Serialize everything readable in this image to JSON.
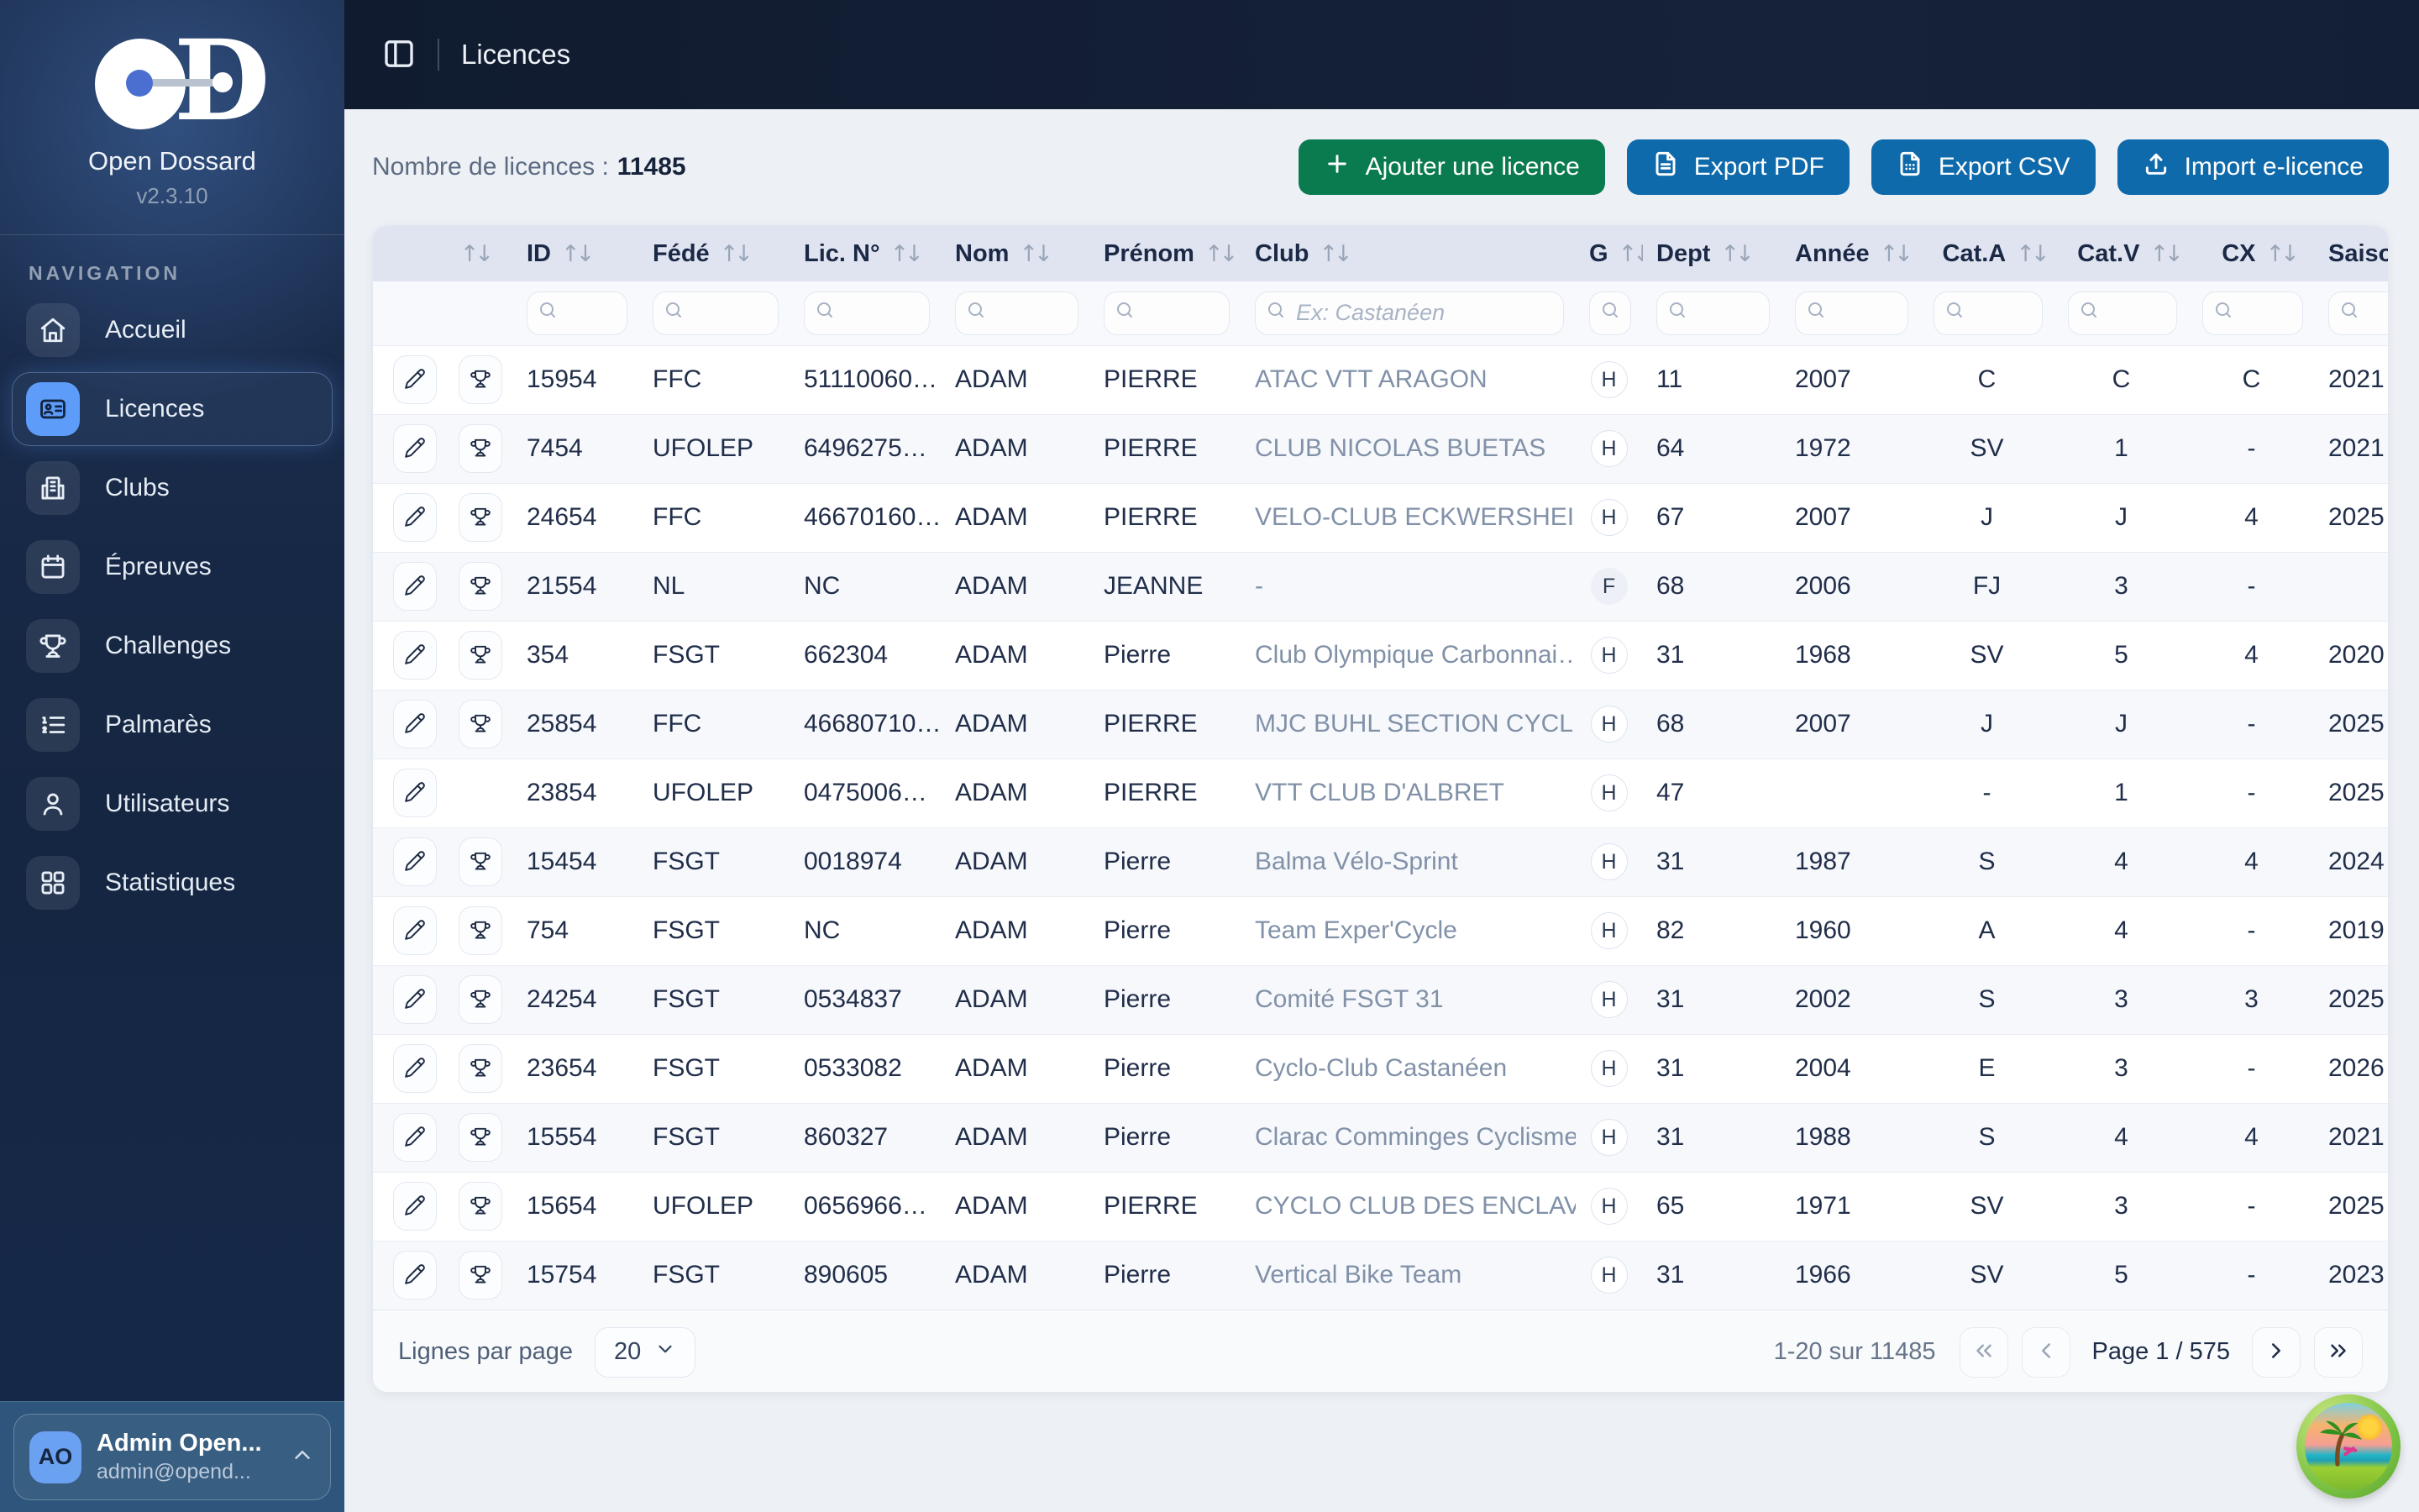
{
  "app": {
    "name": "Open Dossard",
    "version": "v2.3.10"
  },
  "topbar": {
    "title": "Licences"
  },
  "sidebar": {
    "section_label": "NAVIGATION",
    "items": [
      {
        "id": "accueil",
        "label": "Accueil",
        "icon": "home",
        "active": false
      },
      {
        "id": "licences",
        "label": "Licences",
        "icon": "id-card",
        "active": true
      },
      {
        "id": "clubs",
        "label": "Clubs",
        "icon": "building",
        "active": false
      },
      {
        "id": "epreuves",
        "label": "Épreuves",
        "icon": "calendar",
        "active": false
      },
      {
        "id": "challenges",
        "label": "Challenges",
        "icon": "trophy",
        "active": false
      },
      {
        "id": "palmares",
        "label": "Palmarès",
        "icon": "list-ordered",
        "active": false
      },
      {
        "id": "utilisateurs",
        "label": "Utilisateurs",
        "icon": "user",
        "active": false
      },
      {
        "id": "statistiques",
        "label": "Statistiques",
        "icon": "grid",
        "active": false
      }
    ],
    "user": {
      "initials": "AO",
      "name": "Admin Open...",
      "email": "admin@opend..."
    }
  },
  "header": {
    "count_label": "Nombre de licences :",
    "count": "11485",
    "buttons": [
      {
        "id": "add-licence",
        "label": "Ajouter une licence",
        "icon": "plus",
        "bg": "#0a7b4f"
      },
      {
        "id": "export-pdf",
        "label": "Export PDF",
        "icon": "file-text",
        "bg": "#0f6aab"
      },
      {
        "id": "export-csv",
        "label": "Export CSV",
        "icon": "file-csv",
        "bg": "#0f6aab"
      },
      {
        "id": "import-elicence",
        "label": "Import e-licence",
        "icon": "upload",
        "bg": "#0f6aab"
      }
    ]
  },
  "table": {
    "columns": [
      {
        "key": "actions",
        "label": "",
        "filter": false
      },
      {
        "key": "id",
        "label": "ID",
        "filter": true
      },
      {
        "key": "fede",
        "label": "Fédé",
        "filter": true
      },
      {
        "key": "lic",
        "label": "Lic. N°",
        "filter": true
      },
      {
        "key": "nom",
        "label": "Nom",
        "filter": true
      },
      {
        "key": "prenom",
        "label": "Prénom",
        "filter": true
      },
      {
        "key": "club",
        "label": "Club",
        "filter": true,
        "filter_placeholder": "Ex: Castanéen"
      },
      {
        "key": "g",
        "label": "G",
        "filter": true
      },
      {
        "key": "dept",
        "label": "Dept",
        "filter": true
      },
      {
        "key": "annee",
        "label": "Année",
        "filter": true
      },
      {
        "key": "cat_a",
        "label": "Cat.A",
        "filter": true
      },
      {
        "key": "cat_v",
        "label": "Cat.V",
        "filter": true
      },
      {
        "key": "cx",
        "label": "CX",
        "filter": true
      },
      {
        "key": "saison",
        "label": "Saison",
        "filter": true
      }
    ],
    "rows": [
      {
        "actions": [
          "edit",
          "palmares"
        ],
        "id": "15954",
        "fede": "FFC",
        "lic": "51110060…",
        "nom": "ADAM",
        "prenom": "PIERRE",
        "club": "ATAC VTT ARAGON",
        "g": "H",
        "dept": "11",
        "annee": "2007",
        "cat_a": "C",
        "cat_v": "C",
        "cx": "C",
        "saison": "2021"
      },
      {
        "actions": [
          "edit",
          "palmares"
        ],
        "id": "7454",
        "fede": "UFOLEP",
        "lic": "6496275…",
        "nom": "ADAM",
        "prenom": "PIERRE",
        "club": "CLUB NICOLAS BUETAS",
        "g": "H",
        "dept": "64",
        "annee": "1972",
        "cat_a": "SV",
        "cat_v": "1",
        "cx": "-",
        "saison": "2021"
      },
      {
        "actions": [
          "edit",
          "palmares"
        ],
        "id": "24654",
        "fede": "FFC",
        "lic": "46670160…",
        "nom": "ADAM",
        "prenom": "PIERRE",
        "club": "VELO-CLUB ECKWERSHEIM",
        "g": "H",
        "dept": "67",
        "annee": "2007",
        "cat_a": "J",
        "cat_v": "J",
        "cx": "4",
        "saison": "2025"
      },
      {
        "actions": [
          "edit",
          "palmares"
        ],
        "id": "21554",
        "fede": "NL",
        "lic": "NC",
        "nom": "ADAM",
        "prenom": "JEANNE",
        "club": "-",
        "g": "F",
        "dept": "68",
        "annee": "2006",
        "cat_a": "FJ",
        "cat_v": "3",
        "cx": "-",
        "saison": ""
      },
      {
        "actions": [
          "edit",
          "palmares"
        ],
        "id": "354",
        "fede": "FSGT",
        "lic": "662304",
        "nom": "ADAM",
        "prenom": "Pierre",
        "club": "Club Olympique Carbonnai…",
        "g": "H",
        "dept": "31",
        "annee": "1968",
        "cat_a": "SV",
        "cat_v": "5",
        "cx": "4",
        "saison": "2020"
      },
      {
        "actions": [
          "edit",
          "palmares"
        ],
        "id": "25854",
        "fede": "FFC",
        "lic": "46680710…",
        "nom": "ADAM",
        "prenom": "PIERRE",
        "club": "MJC BUHL SECTION CYCL…",
        "g": "H",
        "dept": "68",
        "annee": "2007",
        "cat_a": "J",
        "cat_v": "J",
        "cx": "-",
        "saison": "2025"
      },
      {
        "actions": [
          "edit"
        ],
        "id": "23854",
        "fede": "UFOLEP",
        "lic": "0475006…",
        "nom": "ADAM",
        "prenom": "PIERRE",
        "club": "VTT CLUB D'ALBRET",
        "g": "H",
        "dept": "47",
        "annee": "",
        "cat_a": "-",
        "cat_v": "1",
        "cx": "-",
        "saison": "2025"
      },
      {
        "actions": [
          "edit",
          "palmares"
        ],
        "id": "15454",
        "fede": "FSGT",
        "lic": "0018974",
        "nom": "ADAM",
        "prenom": "Pierre",
        "club": "Balma Vélo-Sprint",
        "g": "H",
        "dept": "31",
        "annee": "1987",
        "cat_a": "S",
        "cat_v": "4",
        "cx": "4",
        "saison": "2024"
      },
      {
        "actions": [
          "edit",
          "palmares"
        ],
        "id": "754",
        "fede": "FSGT",
        "lic": "NC",
        "nom": "ADAM",
        "prenom": "Pierre",
        "club": "Team Exper'Cycle",
        "g": "H",
        "dept": "82",
        "annee": "1960",
        "cat_a": "A",
        "cat_v": "4",
        "cx": "-",
        "saison": "2019"
      },
      {
        "actions": [
          "edit",
          "palmares"
        ],
        "id": "24254",
        "fede": "FSGT",
        "lic": "0534837",
        "nom": "ADAM",
        "prenom": "Pierre",
        "club": "Comité FSGT 31",
        "g": "H",
        "dept": "31",
        "annee": "2002",
        "cat_a": "S",
        "cat_v": "3",
        "cx": "3",
        "saison": "2025"
      },
      {
        "actions": [
          "edit",
          "palmares"
        ],
        "id": "23654",
        "fede": "FSGT",
        "lic": "0533082",
        "nom": "ADAM",
        "prenom": "Pierre",
        "club": "Cyclo-Club Castanéen",
        "g": "H",
        "dept": "31",
        "annee": "2004",
        "cat_a": "E",
        "cat_v": "3",
        "cx": "-",
        "saison": "2026"
      },
      {
        "actions": [
          "edit",
          "palmares"
        ],
        "id": "15554",
        "fede": "FSGT",
        "lic": "860327",
        "nom": "ADAM",
        "prenom": "Pierre",
        "club": "Clarac Comminges Cyclisme",
        "g": "H",
        "dept": "31",
        "annee": "1988",
        "cat_a": "S",
        "cat_v": "4",
        "cx": "4",
        "saison": "2021"
      },
      {
        "actions": [
          "edit",
          "palmares"
        ],
        "id": "15654",
        "fede": "UFOLEP",
        "lic": "0656966…",
        "nom": "ADAM",
        "prenom": "PIERRE",
        "club": "CYCLO CLUB DES ENCLAV…",
        "g": "H",
        "dept": "65",
        "annee": "1971",
        "cat_a": "SV",
        "cat_v": "3",
        "cx": "-",
        "saison": "2025"
      },
      {
        "actions": [
          "edit",
          "palmares"
        ],
        "id": "15754",
        "fede": "FSGT",
        "lic": "890605",
        "nom": "ADAM",
        "prenom": "Pierre",
        "club": "Vertical Bike Team",
        "g": "H",
        "dept": "31",
        "annee": "1966",
        "cat_a": "SV",
        "cat_v": "5",
        "cx": "-",
        "saison": "2023"
      }
    ]
  },
  "pagination": {
    "rows_per_page_label": "Lignes par page",
    "rows_per_page": "20",
    "range_label": "1-20 sur 11485",
    "page_label": "Page 1 / 575"
  }
}
